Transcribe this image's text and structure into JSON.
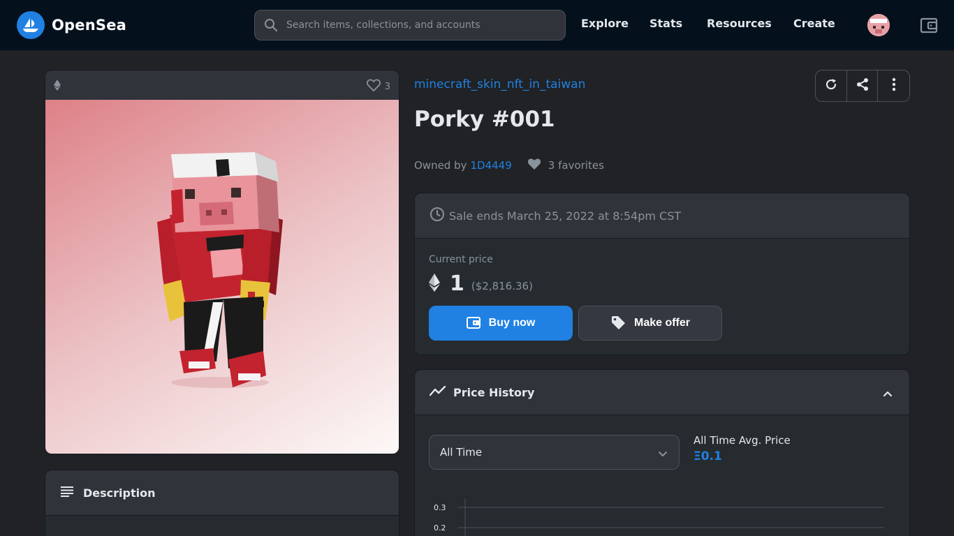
{
  "nav": {
    "brand": "OpenSea",
    "search_placeholder": "Search items, collections, and accounts",
    "links": [
      "Explore",
      "Stats",
      "Resources",
      "Create"
    ]
  },
  "media": {
    "favorites_count": "3"
  },
  "description": {
    "title": "Description"
  },
  "item": {
    "collection": "minecraft_skin_nft_in_taiwan",
    "title": "Porky #001",
    "owned_by_label": "Owned by",
    "owner": "1D4449",
    "favorites": "3 favorites"
  },
  "trade": {
    "sale_ends": "Sale ends March 25, 2022 at 8:54pm CST",
    "current_price_label": "Current price",
    "price": "1",
    "price_usd": "($2,816.36)",
    "buy_label": "Buy now",
    "offer_label": "Make offer"
  },
  "price_history": {
    "title": "Price History",
    "range": "All Time",
    "avg_label": "All Time Avg. Price",
    "avg_value": "Ξ0.1"
  },
  "chart_data": {
    "type": "line",
    "ytick_labels": [
      "0.3",
      "0.2"
    ]
  },
  "colors": {
    "accent": "#2081e2",
    "nav_bg": "#04111d",
    "page_bg": "#202225",
    "card_bg": "#303339"
  }
}
